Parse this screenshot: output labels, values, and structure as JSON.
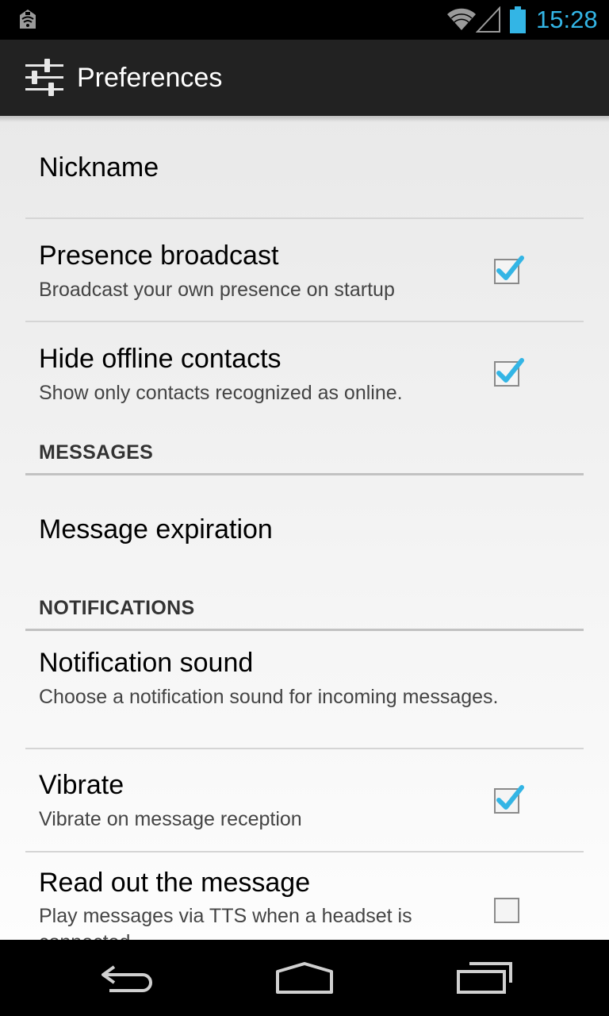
{
  "status_bar": {
    "time": "15:28",
    "time_color": "#33b5e5",
    "icons": [
      "notification-app-icon",
      "wifi-icon",
      "signal-icon",
      "battery-icon"
    ]
  },
  "action_bar": {
    "icon": "sliders-icon",
    "title": "Preferences"
  },
  "preferences": {
    "nickname": {
      "title": "Nickname"
    },
    "presence_broadcast": {
      "title": "Presence broadcast",
      "summary": "Broadcast your own presence on startup",
      "checked": true
    },
    "hide_offline": {
      "title": "Hide offline contacts",
      "summary": "Show only contacts recognized as online.",
      "checked": true
    },
    "messages_category": "MESSAGES",
    "message_expiration": {
      "title": "Message expiration"
    },
    "notifications_category": "NOTIFICATIONS",
    "notification_sound": {
      "title": "Notification sound",
      "summary": "Choose a notification sound for incoming messages."
    },
    "vibrate": {
      "title": "Vibrate",
      "summary": "Vibrate on message reception",
      "checked": true
    },
    "read_out": {
      "title": "Read out the message",
      "summary": "Play messages via TTS when a headset is connected.",
      "checked": false
    }
  },
  "nav_bar": {
    "buttons": [
      "back-icon",
      "home-icon",
      "recents-icon"
    ]
  },
  "colors": {
    "accent": "#33b5e5",
    "action_bar": "#222222"
  }
}
